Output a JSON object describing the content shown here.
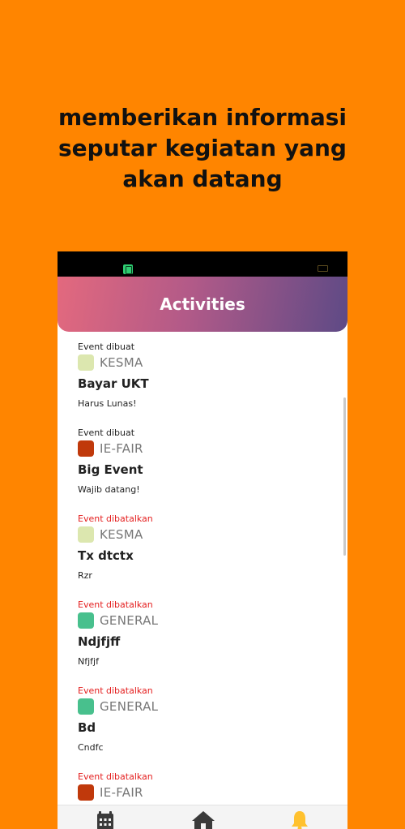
{
  "headline": {
    "line1": "memberikan informasi",
    "line2": "seputar kegiatan yang",
    "line3": "akan datang"
  },
  "appbar": {
    "title": "Activities"
  },
  "colors": {
    "background": "#FF8500",
    "kesma": "#DCE7AF",
    "ie_fair": "#C0390B",
    "general": "#48C08D",
    "cancel_text": "#E41E1E",
    "bell_active": "#FFC12E",
    "nav_inactive": "#3A3A3A"
  },
  "events": [
    {
      "status": "Event dibuat",
      "category": "KESMA",
      "title": "Bayar UKT",
      "description": "Harus Lunas!"
    },
    {
      "status": "Event dibuat",
      "category": "IE-FAIR",
      "title": "Big Event",
      "description": "Wajib datang!"
    },
    {
      "status": "Event dibatalkan",
      "category": "KESMA",
      "title": "Tx dtctx",
      "description": "Rzr"
    },
    {
      "status": "Event dibatalkan",
      "category": "GENERAL",
      "title": "Ndjfjff",
      "description": "Nfjfjf"
    },
    {
      "status": "Event dibatalkan",
      "category": "GENERAL",
      "title": "Bd",
      "description": "Cndfc"
    },
    {
      "status": "Event dibatalkan",
      "category": "IE-FAIR",
      "title": "",
      "description": ""
    }
  ],
  "bottom_nav": [
    {
      "icon": "calendar-icon",
      "active": false
    },
    {
      "icon": "home-icon",
      "active": false
    },
    {
      "icon": "bell-icon",
      "active": true
    }
  ]
}
